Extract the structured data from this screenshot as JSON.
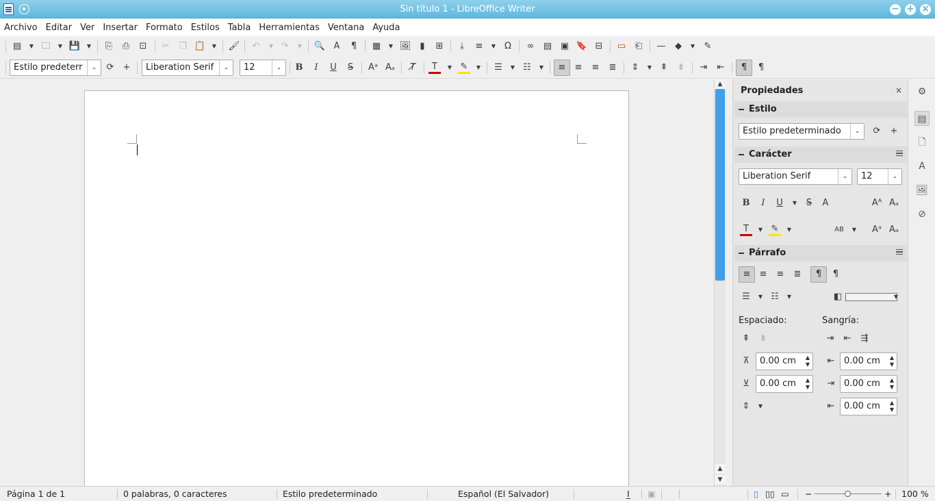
{
  "window": {
    "title": "Sin título 1 - LibreOffice Writer"
  },
  "menu": [
    "Archivo",
    "Editar",
    "Ver",
    "Insertar",
    "Formato",
    "Estilos",
    "Tabla",
    "Herramientas",
    "Ventana",
    "Ayuda"
  ],
  "formatting": {
    "paragraph_style": "Estilo predeterr",
    "font_name": "Liberation Serif",
    "font_size": "12"
  },
  "sidebar": {
    "title": "Propiedades",
    "close_glyph": "×",
    "style_section": {
      "label": "Estilo",
      "value": "Estilo predeterminado"
    },
    "character_section": {
      "label": "Carácter",
      "font_name": "Liberation Serif",
      "font_size": "12"
    },
    "paragraph_section": {
      "label": "Párrafo",
      "spacing_label": "Espaciado:",
      "indent_label": "Sangría:",
      "above_spacing": "0.00 cm",
      "below_spacing": "0.00 cm",
      "before_indent": "0.00 cm",
      "after_indent": "0.00 cm",
      "first_line_indent": "0.00 cm"
    }
  },
  "status": {
    "page": "Página 1 de 1",
    "words": "0 palabras, 0 caracteres",
    "page_style": "Estilo predeterminado",
    "language": "Español (El Salvador)",
    "zoom": "100 %"
  },
  "scroll": {
    "vertical_position": 0,
    "visible_fraction": 0.48
  },
  "colors": {
    "accent": "#3f9fe8",
    "titlebar": "#5db8de",
    "font_color": "#cc0000",
    "highlight": "#f5e500"
  }
}
